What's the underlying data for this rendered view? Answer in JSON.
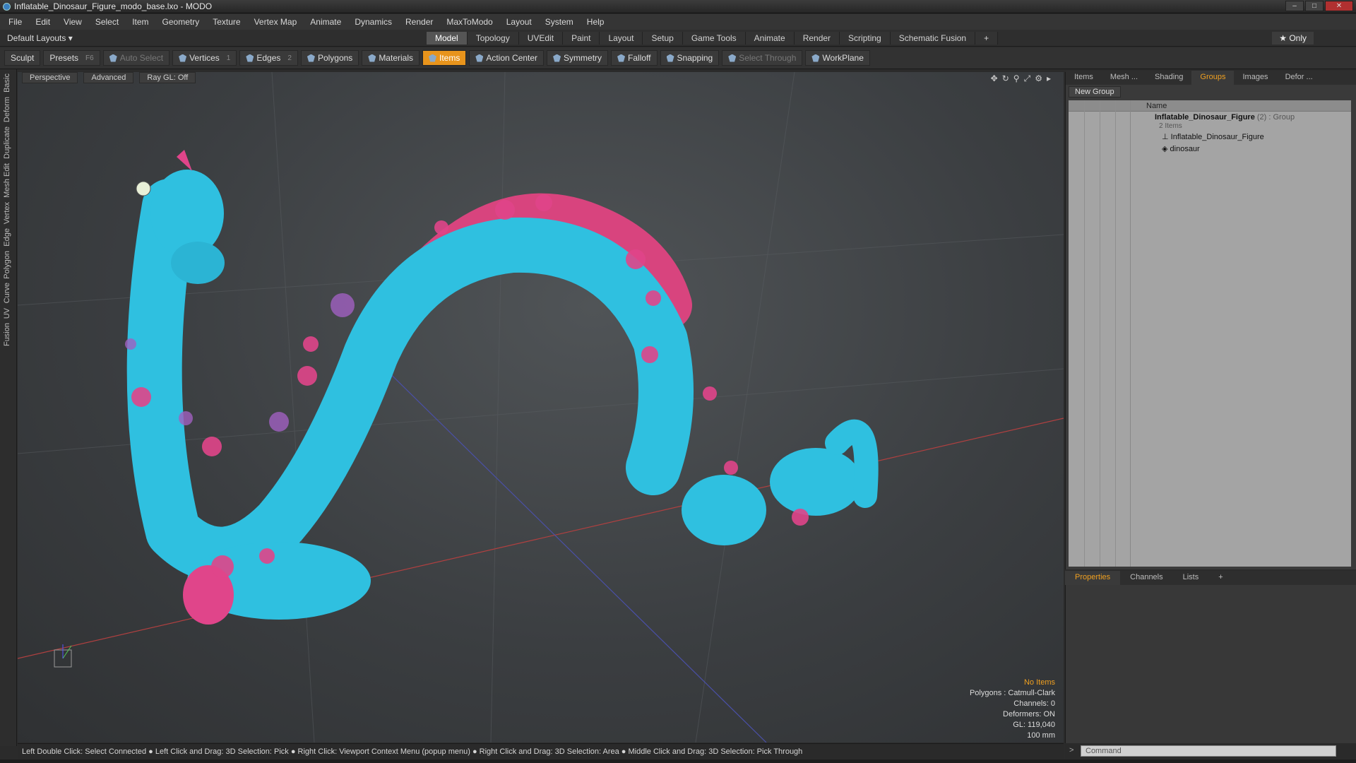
{
  "window": {
    "title": "Inflatable_Dinosaur_Figure_modo_base.lxo - MODO"
  },
  "menu": [
    "File",
    "Edit",
    "View",
    "Select",
    "Item",
    "Geometry",
    "Texture",
    "Vertex Map",
    "Animate",
    "Dynamics",
    "Render",
    "MaxToModo",
    "Layout",
    "System",
    "Help"
  ],
  "layout": {
    "selector": "Default Layouts ▾",
    "tabs": [
      "Model",
      "Topology",
      "UVEdit",
      "Paint",
      "Layout",
      "Setup",
      "Game Tools",
      "Animate",
      "Render",
      "Scripting",
      "Schematic Fusion"
    ],
    "active_tab": "Model",
    "only": "★ Only"
  },
  "toolbar": {
    "sculpt": "Sculpt",
    "presets": "Presets",
    "presets_key": "F6",
    "auto_select": "Auto Select",
    "vertices": "Vertices",
    "vertices_count": "1",
    "edges": "Edges",
    "edges_count": "2",
    "polygons": "Polygons",
    "materials": "Materials",
    "items": "Items",
    "action_center": "Action Center",
    "symmetry": "Symmetry",
    "falloff": "Falloff",
    "snapping": "Snapping",
    "select_through": "Select Through",
    "workplane": "WorkPlane"
  },
  "left_tabs": [
    "Basic",
    "Deform",
    "Duplicate",
    "Mesh Edit",
    "Vertex",
    "Edge",
    "Polygon",
    "Curve",
    "UV",
    "Fusion"
  ],
  "viewport": {
    "perspective": "Perspective",
    "advanced": "Advanced",
    "raygl": "Ray GL: Off",
    "stats": {
      "no_items": "No Items",
      "polygons": "Polygons : Catmull-Clark",
      "channels": "Channels: 0",
      "deformers": "Deformers: ON",
      "gl": "GL: 119,040",
      "scale": "100 mm"
    }
  },
  "status": "Left Double Click: Select Connected ● Left Click and Drag: 3D Selection: Pick ● Right Click: Viewport Context Menu (popup menu) ● Right Click and Drag: 3D Selection: Area ● Middle Click and Drag: 3D Selection: Pick Through",
  "right_tabs": [
    "Items",
    "Mesh ...",
    "Shading",
    "Groups",
    "Images",
    "Defor ..."
  ],
  "right_active": "Groups",
  "groups": {
    "new_group": "New Group",
    "col_name": "Name",
    "group_name": "Inflatable_Dinosaur_Figure",
    "group_suffix": "(2) : Group",
    "group_count": "2 Items",
    "children": [
      "Inflatable_Dinosaur_Figure",
      "dinosaur"
    ]
  },
  "props_tabs": [
    "Properties",
    "Channels",
    "Lists",
    "+"
  ],
  "props_active": "Properties",
  "command": {
    "placeholder": "Command"
  },
  "colors": {
    "accent": "#f0a020",
    "dino_body": "#2fc0e0",
    "dino_spots": "#e0458a"
  }
}
